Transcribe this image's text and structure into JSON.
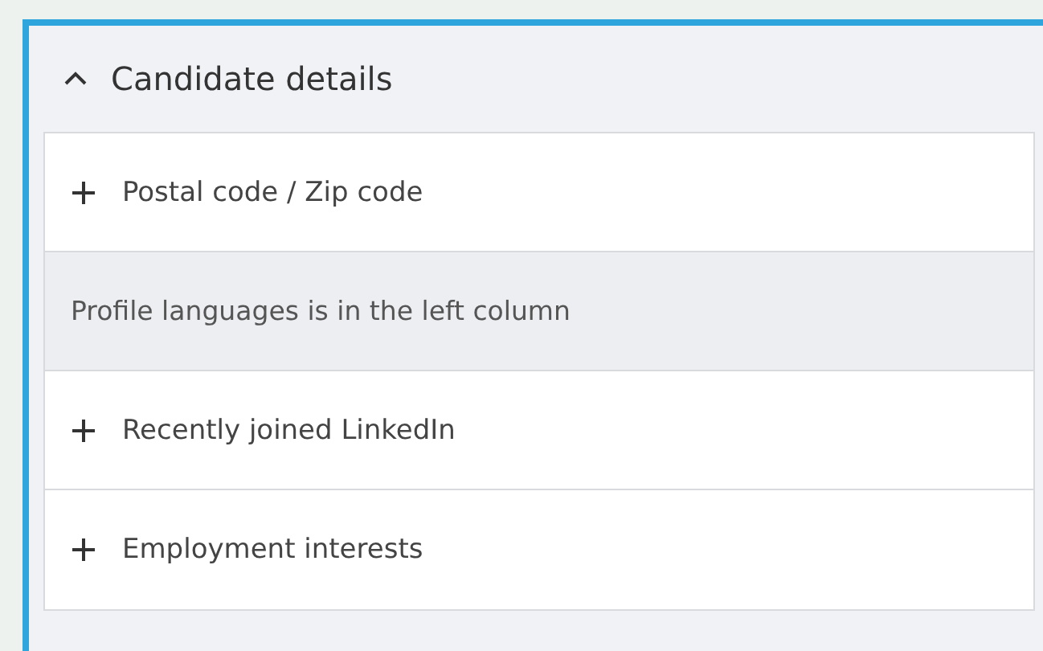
{
  "section": {
    "title": "Candidate details",
    "expanded": true
  },
  "rows": [
    {
      "kind": "filter",
      "label": "Postal code / Zip code"
    },
    {
      "kind": "note",
      "label": "Profile languages is in the left column"
    },
    {
      "kind": "filter",
      "label": "Recently joined LinkedIn"
    },
    {
      "kind": "filter",
      "label": "Employment interests"
    }
  ]
}
